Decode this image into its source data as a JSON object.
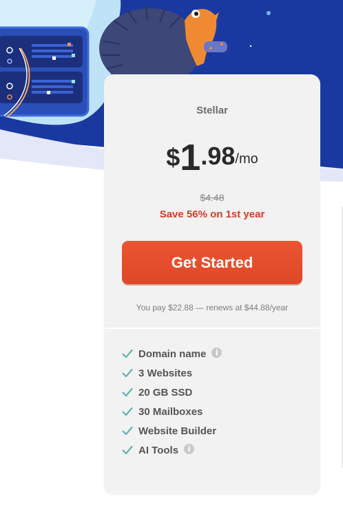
{
  "plan": {
    "name": "Stellar",
    "currency": "$",
    "price_int": "1",
    "price_dec": ".98",
    "per": "/mo",
    "old_price": "$4.48",
    "save_text": "Save 56% on 1st year",
    "cta_label": "Get Started",
    "renew_text": "You pay $22.88 — renews at $44.88/year"
  },
  "features": [
    {
      "label": "Domain name",
      "info": true
    },
    {
      "label": "3 Websites",
      "info": false
    },
    {
      "label": "20 GB SSD",
      "info": false
    },
    {
      "label": "30 Mailboxes",
      "info": false
    },
    {
      "label": "Website Builder",
      "info": false
    },
    {
      "label": "AI Tools",
      "info": true
    }
  ],
  "icons": {
    "feature_check": "check-icon",
    "feature_info": "info-icon"
  },
  "colors": {
    "hero_blue": "#1c3a9f",
    "cta": "#e4502d",
    "save": "#d63a27",
    "check": "#5fb3ad"
  }
}
